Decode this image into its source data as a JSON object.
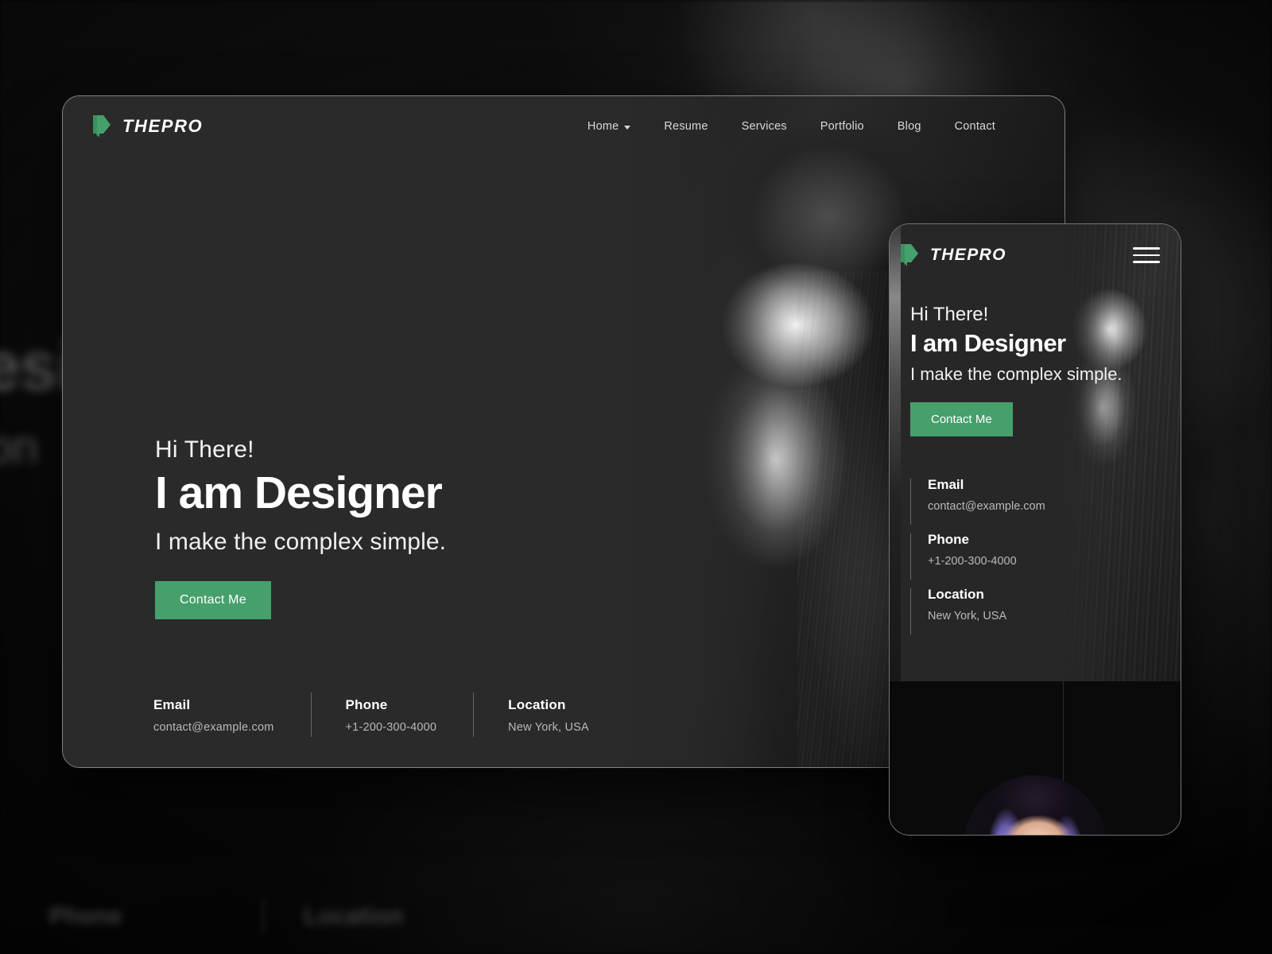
{
  "brand": {
    "name": "THEPRO",
    "logo_icon": "green-arrow-logo-icon",
    "accent_color": "#46a06c"
  },
  "desktop": {
    "nav": {
      "items": [
        {
          "label": "Home",
          "has_dropdown": true
        },
        {
          "label": "Resume",
          "has_dropdown": false
        },
        {
          "label": "Services",
          "has_dropdown": false
        },
        {
          "label": "Portfolio",
          "has_dropdown": false
        },
        {
          "label": "Blog",
          "has_dropdown": false
        },
        {
          "label": "Contact",
          "has_dropdown": false
        }
      ]
    },
    "hero": {
      "greeting": "Hi There!",
      "headline": "I am Designer",
      "subline": "I make the complex simple.",
      "cta_label": "Contact Me"
    },
    "contact_info": [
      {
        "label": "Email",
        "value": "contact@example.com"
      },
      {
        "label": "Phone",
        "value": "+1-200-300-4000"
      },
      {
        "label": "Location",
        "value": "New York, USA"
      }
    ]
  },
  "mobile": {
    "brand_name": "THEPRO",
    "menu_icon": "hamburger-menu-icon",
    "hero": {
      "greeting": "Hi There!",
      "headline": "I am Designer",
      "subline": "I make the complex simple.",
      "cta_label": "Contact Me"
    },
    "contact_info": [
      {
        "label": "Email",
        "value": "contact@example.com"
      },
      {
        "label": "Phone",
        "value": "+1-200-300-4000"
      },
      {
        "label": "Location",
        "value": "New York, USA"
      }
    ]
  },
  "background_ghost": {
    "fragment_1": "esi",
    "fragment_2": "on",
    "fragment_3": "Phone",
    "fragment_4": "Location"
  }
}
